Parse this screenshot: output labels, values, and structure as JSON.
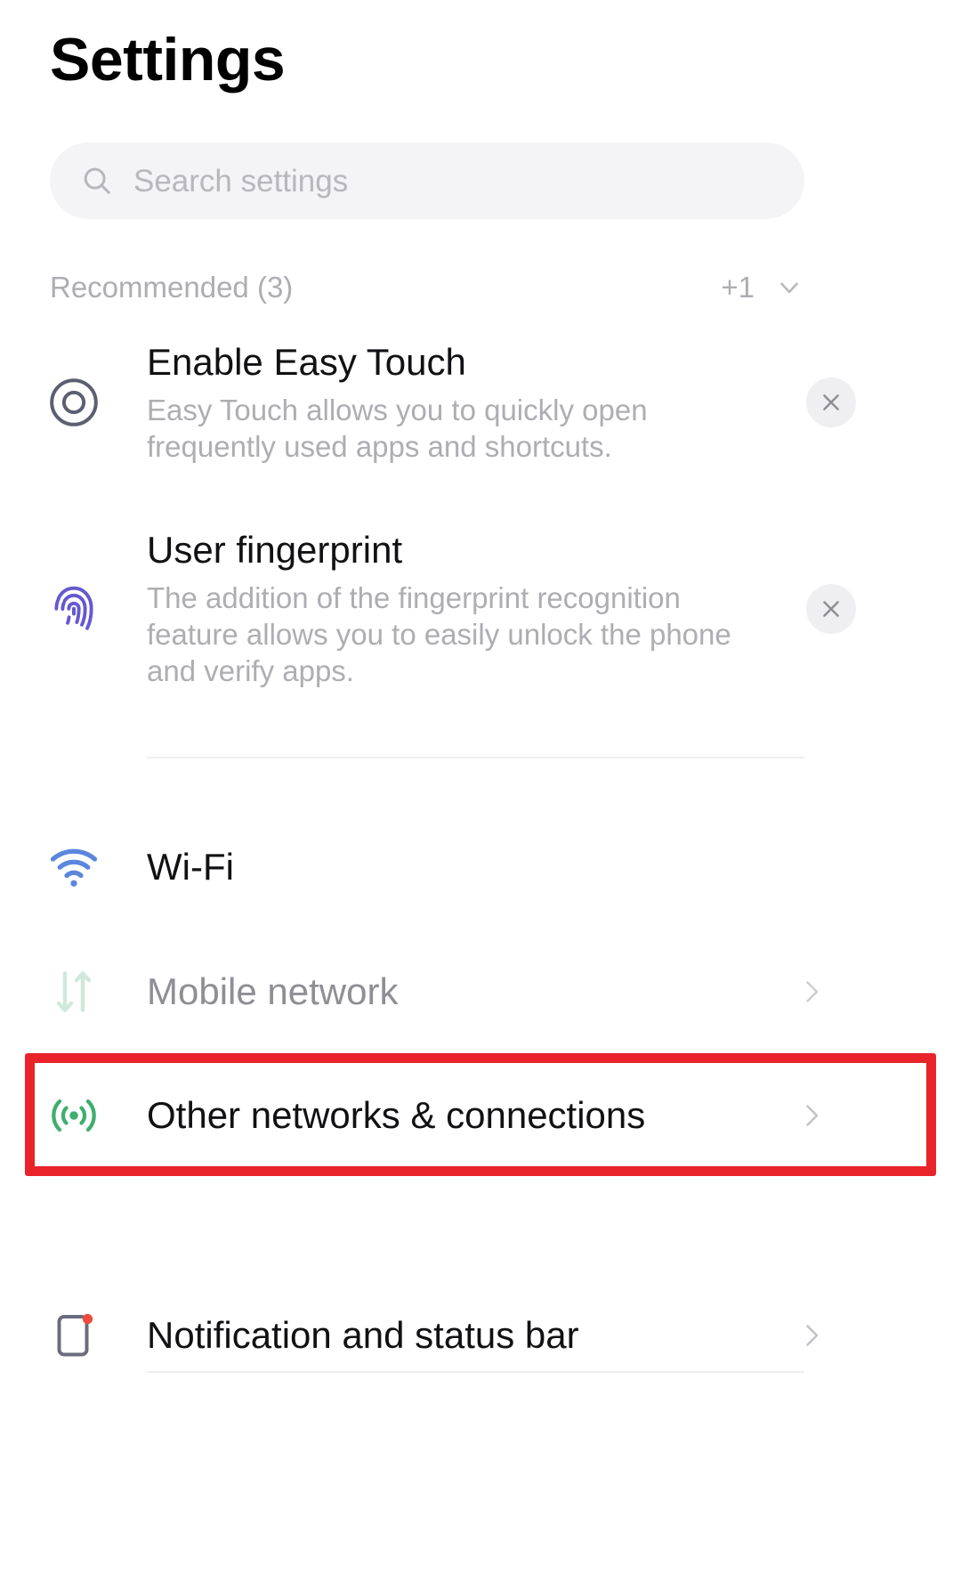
{
  "header": {
    "title": "Settings"
  },
  "search": {
    "placeholder": "Search settings",
    "icon": "search-icon"
  },
  "recommended": {
    "section_label": "Recommended (3)",
    "extra_count": "+1",
    "expand_icon": "chevron-down-icon",
    "items": [
      {
        "icon": "easy-touch-icon",
        "icon_color": "#5c5f72",
        "title": "Enable Easy Touch",
        "description": "Easy Touch allows you to quickly open frequently used apps and shortcuts.",
        "dismiss_icon": "close-icon"
      },
      {
        "icon": "fingerprint-icon",
        "icon_color": "#6558cf",
        "title": "User fingerprint",
        "description": "The addition of the fingerprint recognition feature allows you to easily unlock the phone and verify apps.",
        "dismiss_icon": "close-icon"
      }
    ]
  },
  "settings_rows": [
    {
      "key": "wifi",
      "label": "Wi-Fi",
      "icon": "wifi-icon",
      "icon_color": "#5b86de",
      "disabled": false,
      "has_chevron": false,
      "highlighted": false
    },
    {
      "key": "mobile-network",
      "label": "Mobile network",
      "icon": "mobile-network-icon",
      "icon_color": "#cfe8dc",
      "disabled": true,
      "has_chevron": true,
      "highlighted": false
    },
    {
      "key": "other-networks",
      "label": "Other networks & connections",
      "icon": "broadcast-signal-icon",
      "icon_color": "#3fae6e",
      "disabled": false,
      "has_chevron": true,
      "highlighted": true
    },
    {
      "key": "notification-status-bar",
      "label": "Notification and status bar",
      "icon": "notification-badge-icon",
      "icon_color": "#6b6c7e",
      "disabled": false,
      "has_chevron": true,
      "highlighted": false
    }
  ],
  "annotation": {
    "highlight_color": "#e8232a",
    "target": "Other networks & connections"
  }
}
